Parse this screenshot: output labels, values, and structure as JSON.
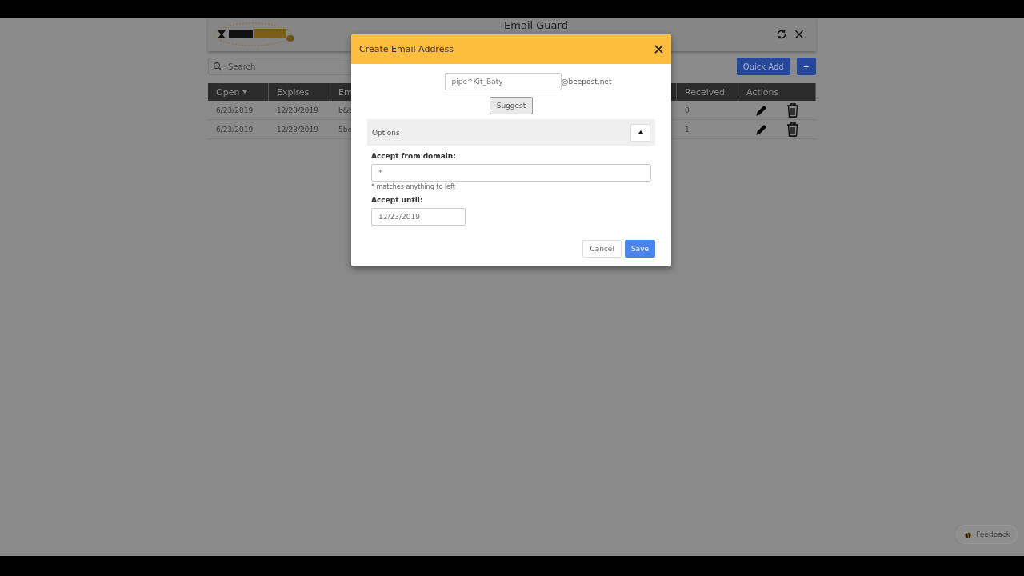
{
  "app": {
    "title": "Email Guard",
    "search": {
      "placeholder": "Search"
    },
    "buttons": {
      "quick_add": "Quick Add",
      "add": "+"
    }
  },
  "table": {
    "columns": [
      {
        "label": "Open",
        "sorted": true
      },
      {
        "label": "Expires"
      },
      {
        "label": "Em"
      },
      {
        "label": "Received"
      },
      {
        "label": "Actions"
      }
    ],
    "rows": [
      [
        "6/23/2019",
        "12/23/2019",
        "b&b",
        "0"
      ],
      [
        "6/23/2019",
        "12/23/2019",
        "5be",
        "1"
      ]
    ]
  },
  "dialog": {
    "title": "Create Email Address",
    "address": {
      "value": "pipe^Kit_Baty",
      "domain": "@beepost.net"
    },
    "suggest": "Suggest",
    "options": {
      "label": "Options",
      "expanded": true
    },
    "accept_from": {
      "label": "Accept from domain:",
      "value": "*",
      "hint": "* matches anything to left"
    },
    "accept_until": {
      "label": "Accept until:",
      "value": "12/23/2019"
    },
    "buttons": {
      "cancel": "Cancel",
      "save": "Save"
    }
  },
  "feedback": "Feedback"
}
